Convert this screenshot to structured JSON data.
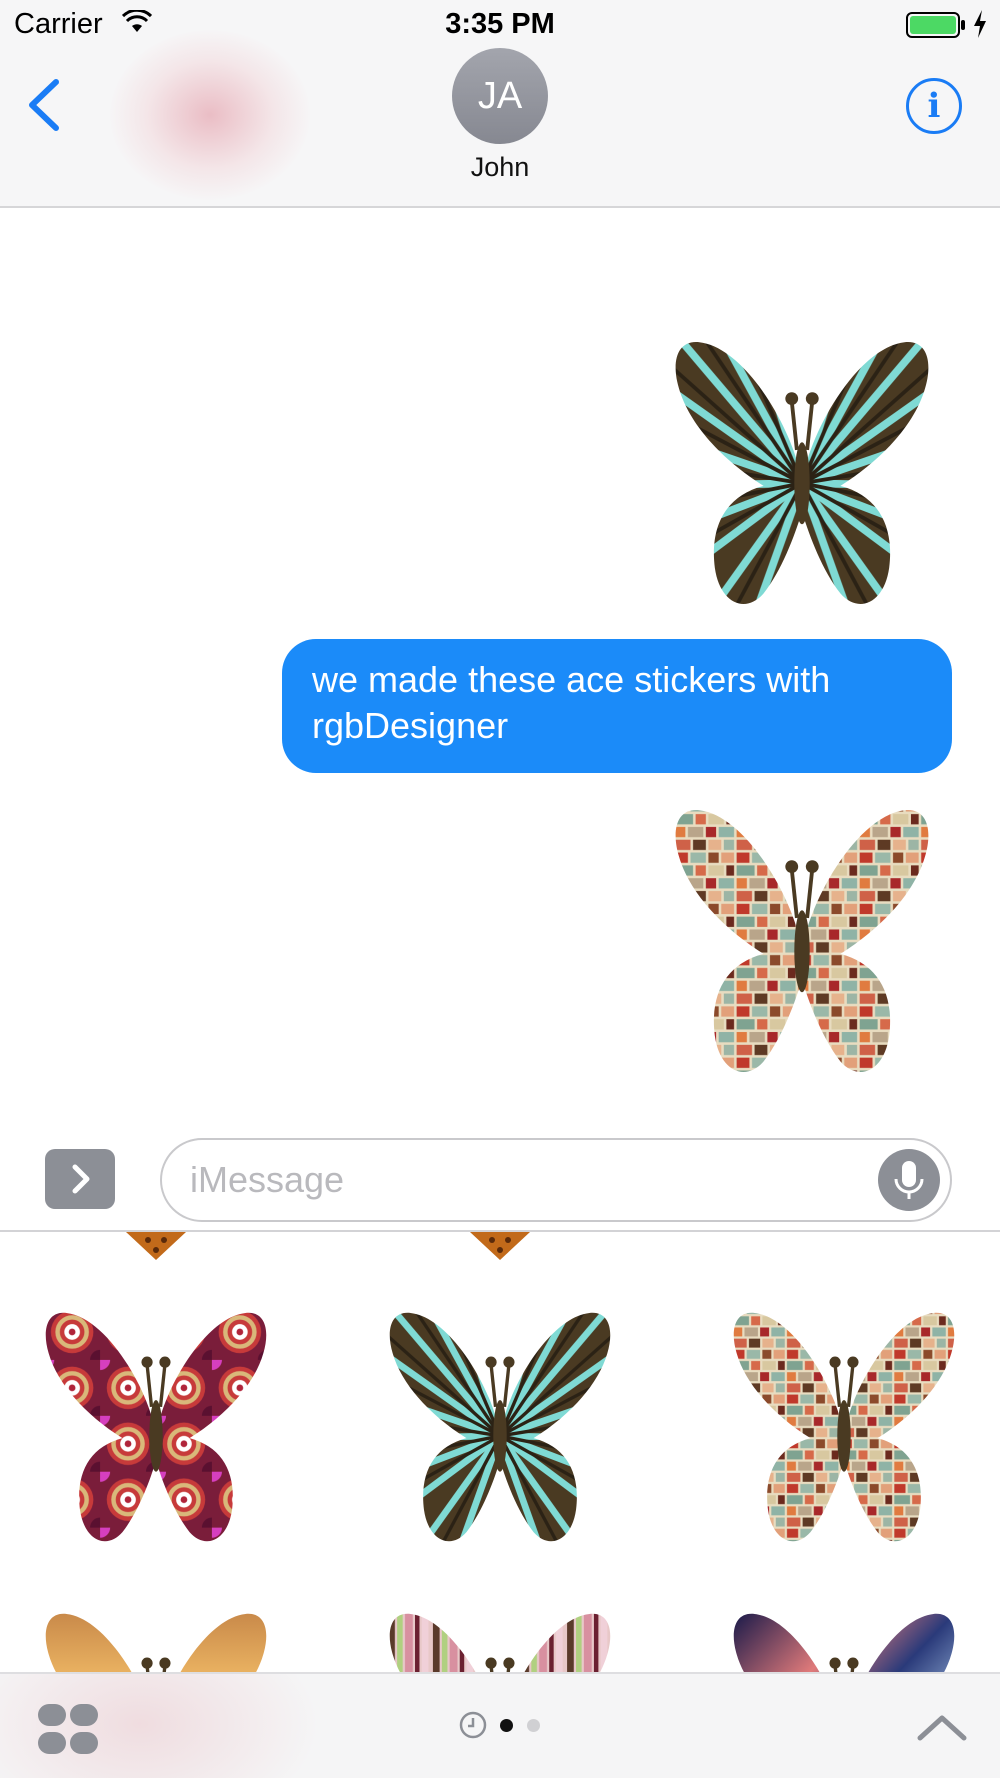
{
  "status_bar": {
    "carrier": "Carrier",
    "time": "3:35 PM",
    "battery_color": "#4cd964"
  },
  "header": {
    "avatar_initials": "JA",
    "contact_name": "John",
    "info_label": "i",
    "accent_color": "#1a7cf5"
  },
  "messages": [
    {
      "type": "sticker",
      "sticker": "radial-stripe-butterfly"
    },
    {
      "type": "text",
      "text": "we made these ace stickers with rgbDesigner",
      "bubble_color": "#1b8bf9"
    },
    {
      "type": "sticker",
      "sticker": "mosaic-butterfly"
    }
  ],
  "composer": {
    "placeholder": "iMessage",
    "value": ""
  },
  "drawer": {
    "stickers": [
      {
        "name": "circles-butterfly"
      },
      {
        "name": "radial-stripe-butterfly"
      },
      {
        "name": "mosaic-butterfly"
      },
      {
        "name": "orange-stripe-butterfly"
      },
      {
        "name": "pink-bars-butterfly"
      },
      {
        "name": "blue-gradient-butterfly"
      }
    ]
  },
  "bottom_bar": {
    "icons": [
      "app-grid-icon",
      "recents-icon",
      "page-dot",
      "page-dot",
      "chevron-up-icon"
    ],
    "active_page": 1,
    "page_count": 2
  }
}
